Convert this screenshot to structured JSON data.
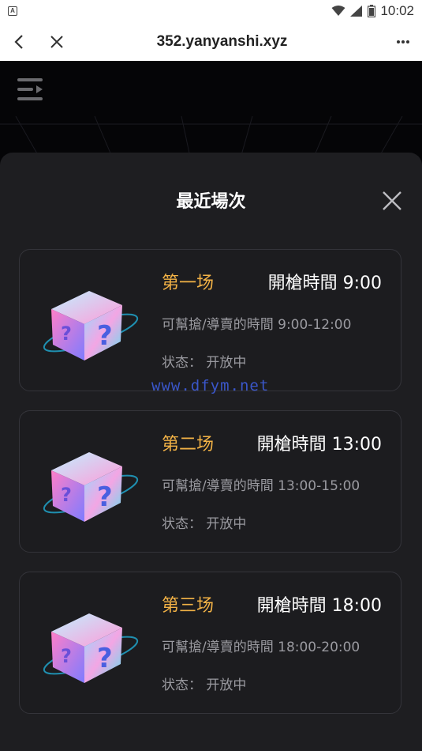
{
  "status_bar": {
    "time": "10:02",
    "app_icon": "A"
  },
  "browser": {
    "title": "352.yanyanshi.xyz",
    "back_icon": "back-arrow-icon",
    "close_icon": "close-icon",
    "more_icon": "more-icon"
  },
  "sheet": {
    "title": "最近場次"
  },
  "sessions": [
    {
      "name": "第一场",
      "time": "開槍時間 9:00",
      "window": "可幫搶/導賣的時間 9:00-12:00",
      "status": "状态： 开放中"
    },
    {
      "name": "第二场",
      "time": "開槍時間 13:00",
      "window": "可幫搶/導賣的時間 13:00-15:00",
      "status": "状态： 开放中"
    },
    {
      "name": "第三场",
      "time": "開槍時間 18:00",
      "window": "可幫搶/導賣的時間 18:00-20:00",
      "status": "状态： 开放中"
    }
  ],
  "watermark": "www.dfym.net",
  "colors": {
    "accent": "#f2b246",
    "sheet_bg": "#1e1e21",
    "watermark": "#3a56c9"
  }
}
